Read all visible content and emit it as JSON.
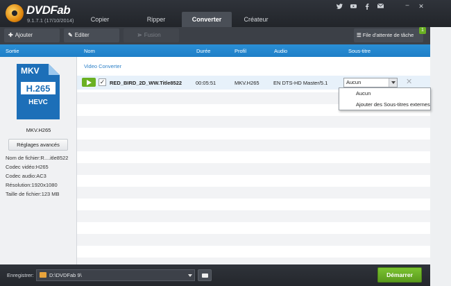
{
  "app": {
    "brand": "DVDFab",
    "version": "9.1.7.1 (17/10/2014)"
  },
  "tabs": [
    {
      "label": "Copier"
    },
    {
      "label": "Ripper"
    },
    {
      "label": "Converter",
      "active": true
    },
    {
      "label": "Créateur"
    }
  ],
  "social_icons": [
    "twitter-icon",
    "youtube-icon",
    "facebook-icon",
    "mail-icon"
  ],
  "window_controls": [
    "minimize-icon",
    "close-icon"
  ],
  "toolbar": {
    "add_label": "Ajouter",
    "edit_label": "Editer",
    "merge_label": "Fusion",
    "queue_label": "File d'attente de tâche",
    "queue_badge": "1"
  },
  "columns": {
    "sortie": "Sortie",
    "nom": "Nom",
    "duree": "Durée",
    "profil": "Profil",
    "audio": "Audio",
    "soustitre": "Sous-titre"
  },
  "sidebar": {
    "icon_format": "MKV",
    "icon_codec": "H.265",
    "icon_sub": "HEVC",
    "profile_name": "MKV.H265",
    "advanced_button": "Réglages avancés",
    "info": [
      "Nom de fichier:R....itle8522",
      "Codec vidéo:H265",
      "Codec audio:AC3",
      "Résolution:1920x1080",
      "Taille de fichier:123 MB"
    ]
  },
  "content": {
    "section": "Video Converter",
    "track": {
      "checked": true,
      "name": "RED_BIRD_2D_WW.Title8522",
      "duration": "00:05:51",
      "profile": "MKV.H265",
      "audio": "EN DTS-HD Master/5.1",
      "subtitle": "Aucun"
    }
  },
  "dropdown": {
    "items": [
      "Aucun",
      "Ajouter des Sous-titres externes"
    ]
  },
  "footer": {
    "save_label": "Enregistrer:",
    "path": "D:\\DVDFab 9\\",
    "start_label": "Démarrer"
  },
  "colors": {
    "accent": "#2a8fd6",
    "start": "#6ab023",
    "titlebar": "#2f333a"
  }
}
